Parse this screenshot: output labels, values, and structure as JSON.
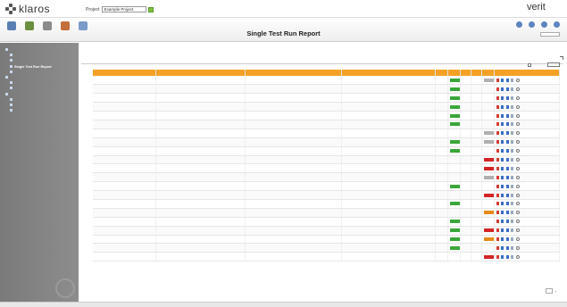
{
  "header": {
    "brand": "klaros",
    "project_label": "Project",
    "project_value": "Example Project",
    "right_text": "",
    "right_link": "",
    "verit_main": "verit",
    "verit_accent": ""
  },
  "toolbar": {
    "title": "Single Test Run Report",
    "tools": [
      {
        "label": "",
        "color": "#5a7fb5",
        "icon": "home-icon"
      },
      {
        "label": "",
        "color": "#6a8f3f",
        "icon": "define-icon"
      },
      {
        "label": "",
        "color": "#8a8a8a",
        "icon": "plan-icon"
      },
      {
        "label": "",
        "color": "#c46e3a",
        "icon": "execute-icon"
      },
      {
        "label": "",
        "color": "#7a9ac8",
        "icon": "evaluate-icon"
      }
    ],
    "search_label": ""
  },
  "sidebar": {
    "items": [
      {
        "label": "",
        "level": 0
      },
      {
        "label": "",
        "level": 1
      },
      {
        "label": "",
        "level": 1
      },
      {
        "label": "Single Test Run Report",
        "level": 1,
        "selected": true
      },
      {
        "label": "",
        "level": 1
      },
      {
        "label": "",
        "level": 0
      },
      {
        "label": "",
        "level": 1
      },
      {
        "label": "",
        "level": 1
      },
      {
        "label": "",
        "level": 0
      },
      {
        "label": "",
        "level": 1
      },
      {
        "label": "",
        "level": 1
      },
      {
        "label": "",
        "level": 1
      }
    ]
  },
  "content": {
    "breadcrumb": "",
    "filter_label": "",
    "filter_label2": "",
    "footer_count": "",
    "pager_text": ""
  },
  "table": {
    "headers": [
      "",
      "",
      "",
      "",
      "",
      "",
      "",
      "",
      "",
      ""
    ],
    "rows": [
      {
        "name": "",
        "summary": "",
        "date": "",
        "version": "",
        "status": "green",
        "result": "grey"
      },
      {
        "name": "",
        "summary": "",
        "date": "",
        "version": "",
        "status": "green",
        "result": ""
      },
      {
        "name": "",
        "summary": "",
        "date": "",
        "version": "",
        "status": "green",
        "result": ""
      },
      {
        "name": "",
        "summary": "",
        "date": "",
        "version": "",
        "status": "green",
        "result": ""
      },
      {
        "name": "",
        "summary": "",
        "date": "",
        "version": "",
        "status": "green",
        "result": ""
      },
      {
        "name": "",
        "summary": "",
        "date": "",
        "version": "",
        "status": "green",
        "result": ""
      },
      {
        "name": "",
        "summary": "",
        "date": "",
        "version": "",
        "status": "",
        "result": "grey"
      },
      {
        "name": "",
        "summary": "",
        "date": "",
        "version": "",
        "status": "green",
        "result": "grey"
      },
      {
        "name": "",
        "summary": "",
        "date": "",
        "version": "",
        "status": "green",
        "result": ""
      },
      {
        "name": "",
        "summary": "",
        "date": "",
        "version": "",
        "status": "",
        "result": "red"
      },
      {
        "name": "",
        "summary": "",
        "date": "",
        "version": "",
        "status": "",
        "result": "red"
      },
      {
        "name": "",
        "summary": "",
        "date": "",
        "version": "",
        "status": "",
        "result": "grey"
      },
      {
        "name": "",
        "summary": "",
        "date": "",
        "version": "",
        "status": "green",
        "result": ""
      },
      {
        "name": "",
        "summary": "",
        "date": "",
        "version": "",
        "status": "",
        "result": "red"
      },
      {
        "name": "",
        "summary": "",
        "date": "",
        "version": "",
        "status": "green",
        "result": ""
      },
      {
        "name": "",
        "summary": "",
        "date": "",
        "version": "",
        "status": "",
        "result": "orange"
      },
      {
        "name": "",
        "summary": "",
        "date": "",
        "version": "",
        "status": "green",
        "result": ""
      },
      {
        "name": "",
        "summary": "",
        "date": "",
        "version": "",
        "status": "green",
        "result": "red"
      },
      {
        "name": "",
        "summary": "",
        "date": "",
        "version": "",
        "status": "green",
        "result": "orange"
      },
      {
        "name": "",
        "summary": "",
        "date": "",
        "version": "",
        "status": "green",
        "result": ""
      },
      {
        "name": "",
        "summary": "",
        "date": "",
        "version": "",
        "status": "",
        "result": "red"
      }
    ]
  },
  "statusbar": {
    "text": ""
  },
  "colors": {
    "header_orange": "#f4a126",
    "status_green": "#3aa63a",
    "status_red": "#d42424",
    "status_orange": "#e88a1a",
    "sidebar_grey": "#858585"
  }
}
